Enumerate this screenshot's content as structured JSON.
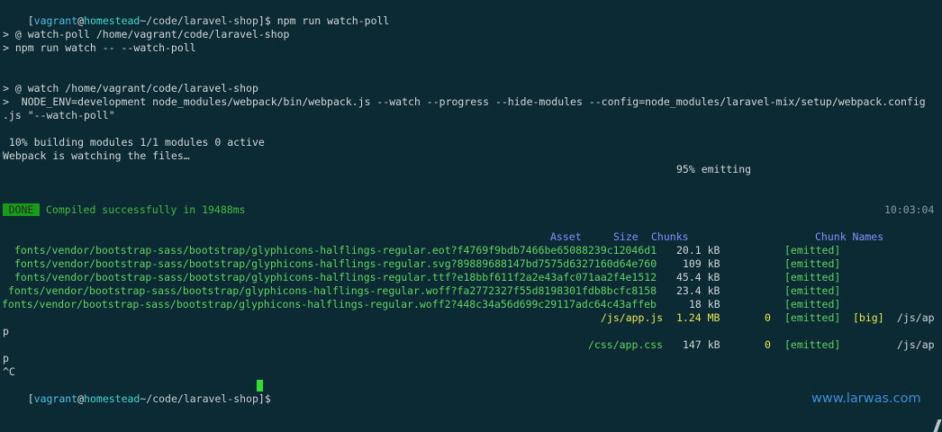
{
  "prompt": {
    "user": "vagrant",
    "at": "@",
    "host": "homestead",
    "path": "~/code/laravel-shop",
    "symbol": "$ "
  },
  "commands": {
    "watch_poll": "npm run watch-poll"
  },
  "output": {
    "line_1": "> @ watch-poll /home/vagrant/code/laravel-shop",
    "line_2": "> npm run watch -- --watch-poll",
    "line_3": "> @ watch /home/vagrant/code/laravel-shop",
    "line_4": ">  NODE_ENV=development node_modules/webpack/bin/webpack.js --watch --progress --hide-modules --config=node_modules/laravel-mix/setup/webpack.config",
    "line_5": ".js \"--watch-poll\"",
    "progress_10": " 10% building modules 1/1 modules 0 active",
    "webpack_watching": "Webpack is watching the files…",
    "progress_95": "95% emitting",
    "done_badge": "DONE",
    "compiled": "Compiled successfully in 19488ms",
    "timestamp": "10:03:04",
    "wrap_p1": "p",
    "wrap_p2": "p",
    "ctrl_c": "^C"
  },
  "asset_table": {
    "headers": {
      "asset": "Asset",
      "size": "Size",
      "chunks": "Chunks",
      "chunk_names": "Chunk Names"
    },
    "rows": [
      {
        "asset": "fonts/vendor/bootstrap-sass/bootstrap/glyphicons-halflings-regular.eot?f4769f9bdb7466be65088239c12046d1",
        "size": "20.1 kB",
        "chunks": "",
        "status": "[emitted]",
        "flag": "",
        "name": ""
      },
      {
        "asset": "fonts/vendor/bootstrap-sass/bootstrap/glyphicons-halflings-regular.svg?89889688147bd7575d6327160d64e760",
        "size": "109 kB",
        "chunks": "",
        "status": "[emitted]",
        "flag": "",
        "name": ""
      },
      {
        "asset": "fonts/vendor/bootstrap-sass/bootstrap/glyphicons-halflings-regular.ttf?e18bbf611f2a2e43afc071aa2f4e1512",
        "size": "45.4 kB",
        "chunks": "",
        "status": "[emitted]",
        "flag": "",
        "name": ""
      },
      {
        "asset": "fonts/vendor/bootstrap-sass/bootstrap/glyphicons-halflings-regular.woff?fa2772327f55d8198301fdb8bcfc8158",
        "size": "23.4 kB",
        "chunks": "",
        "status": "[emitted]",
        "flag": "",
        "name": ""
      },
      {
        "asset": "fonts/vendor/bootstrap-sass/bootstrap/glyphicons-halflings-regular.woff2?448c34a56d699c29117adc64c43affeb",
        "size": "18 kB",
        "chunks": "",
        "status": "[emitted]",
        "flag": "",
        "name": ""
      },
      {
        "asset": "/js/app.js",
        "size": "1.24 MB",
        "chunks": "0",
        "status": "[emitted]",
        "flag": "[big]",
        "name": "/js/ap"
      },
      {
        "asset": "/css/app.css",
        "size": "147 kB",
        "chunks": "0",
        "status": "[emitted]",
        "flag": "",
        "name": "/js/ap"
      }
    ]
  },
  "watermark": "www.larwas.com",
  "colors": {
    "background": "#0c2a34",
    "prompt_user": "#4ac0e6",
    "prompt_host": "#3cd6d0",
    "asset_green": "#5fd35f",
    "header_blue": "#7f8fff",
    "size_yellow": "#e8e84a",
    "done_badge": "#169c16",
    "cursor": "#33dd33",
    "watermark": "#3c8ed4"
  },
  "icons": {
    "cursor": "block-cursor",
    "scrollbar": "scrollbar-thumb"
  }
}
